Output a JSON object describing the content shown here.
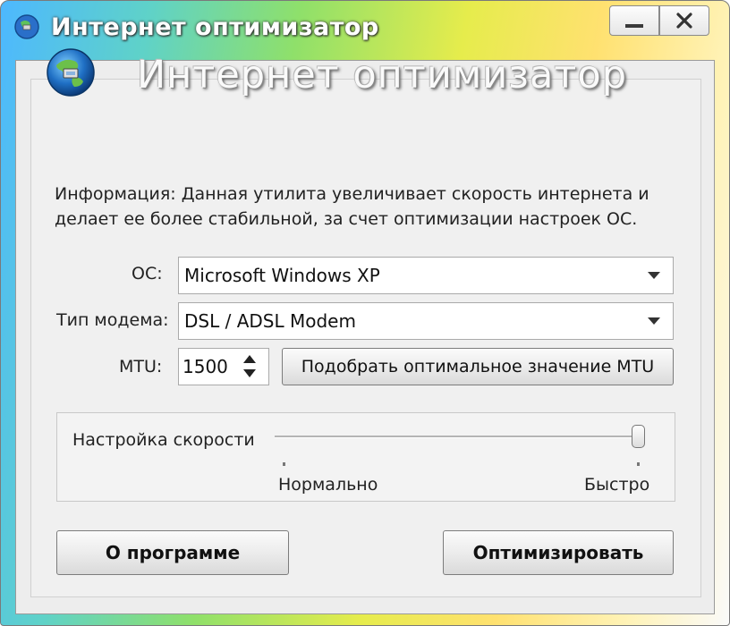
{
  "window": {
    "title": "Интернет оптимизатор",
    "controls": {
      "minimize": "minimize",
      "close": "close"
    }
  },
  "header": {
    "title": "Интернет оптимизатор"
  },
  "info": {
    "line1": "Информация: Данная утилита увеличивает скорость интернета и",
    "line2": "делает ее более стабильной, за счет оптимизации настроек ОС."
  },
  "os": {
    "label": "ОС:",
    "value": "Microsoft Windows XP"
  },
  "modem": {
    "label": "Тип модема:",
    "value": "DSL / ADSL Modem"
  },
  "mtu": {
    "label": "MTU:",
    "value": "1500",
    "auto_button": "Подобрать оптимальное значение MTU"
  },
  "speed": {
    "label": "Настройка скорости",
    "min_label": "Нормально",
    "max_label": "Быстро",
    "level": 1.0
  },
  "buttons": {
    "about": "О программе",
    "optimize": "Оптимизировать"
  },
  "colors": {
    "title_text": "#ffffff",
    "window_bg": "#ededed"
  }
}
